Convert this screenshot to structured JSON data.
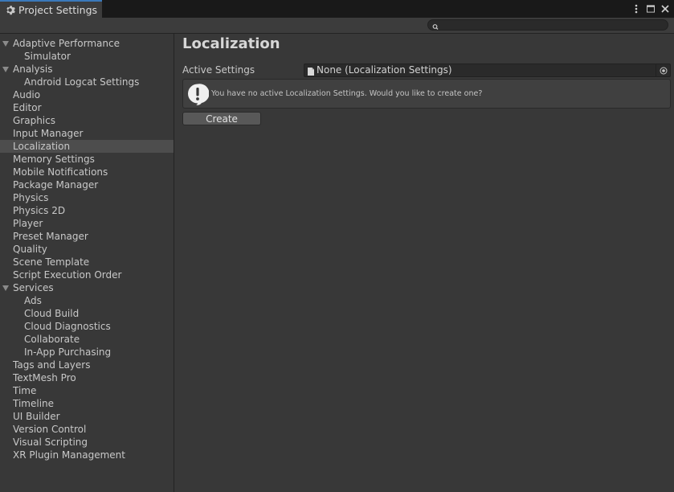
{
  "window": {
    "tab_title": "Project Settings",
    "tab_icon": "gear-icon",
    "accent": "#3a79bb",
    "controls": [
      "more-vert-icon",
      "maximize-icon",
      "close-icon"
    ]
  },
  "search": {
    "placeholder": ""
  },
  "sidebar": {
    "items": [
      {
        "label": "Adaptive Performance",
        "indent": 0,
        "expanded": true
      },
      {
        "label": "Simulator",
        "indent": 1
      },
      {
        "label": "Analysis",
        "indent": 0,
        "expanded": true
      },
      {
        "label": "Android Logcat Settings",
        "indent": 1
      },
      {
        "label": "Audio",
        "indent": 0
      },
      {
        "label": "Editor",
        "indent": 0
      },
      {
        "label": "Graphics",
        "indent": 0
      },
      {
        "label": "Input Manager",
        "indent": 0
      },
      {
        "label": "Localization",
        "indent": 0,
        "selected": true
      },
      {
        "label": "Memory Settings",
        "indent": 0
      },
      {
        "label": "Mobile Notifications",
        "indent": 0
      },
      {
        "label": "Package Manager",
        "indent": 0
      },
      {
        "label": "Physics",
        "indent": 0
      },
      {
        "label": "Physics 2D",
        "indent": 0
      },
      {
        "label": "Player",
        "indent": 0
      },
      {
        "label": "Preset Manager",
        "indent": 0
      },
      {
        "label": "Quality",
        "indent": 0
      },
      {
        "label": "Scene Template",
        "indent": 0
      },
      {
        "label": "Script Execution Order",
        "indent": 0
      },
      {
        "label": "Services",
        "indent": 0,
        "expanded": true
      },
      {
        "label": "Ads",
        "indent": 1
      },
      {
        "label": "Cloud Build",
        "indent": 1
      },
      {
        "label": "Cloud Diagnostics",
        "indent": 1
      },
      {
        "label": "Collaborate",
        "indent": 1
      },
      {
        "label": "In-App Purchasing",
        "indent": 1
      },
      {
        "label": "Tags and Layers",
        "indent": 0
      },
      {
        "label": "TextMesh Pro",
        "indent": 0
      },
      {
        "label": "Time",
        "indent": 0
      },
      {
        "label": "Timeline",
        "indent": 0
      },
      {
        "label": "UI Builder",
        "indent": 0
      },
      {
        "label": "Version Control",
        "indent": 0
      },
      {
        "label": "Visual Scripting",
        "indent": 0
      },
      {
        "label": "XR Plugin Management",
        "indent": 0
      }
    ]
  },
  "main": {
    "title": "Localization",
    "active_settings_label": "Active Settings",
    "active_settings_value": "None (Localization Settings)",
    "help_message": "You have no active Localization Settings. Would you like to create one?",
    "create_label": "Create"
  }
}
